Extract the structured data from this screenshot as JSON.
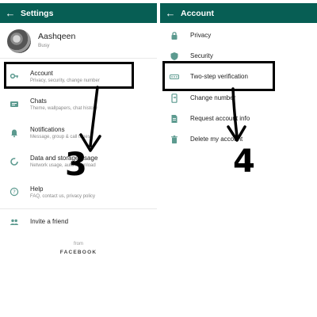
{
  "left_screen": {
    "appbar": {
      "title": "Settings",
      "back_icon": "arrow-left-icon"
    },
    "profile": {
      "name": "Aashqeen",
      "status": "Busy"
    },
    "items": [
      {
        "icon": "key-icon",
        "label": "Account",
        "sub": "Privacy, security, change number"
      },
      {
        "icon": "chat-icon",
        "label": "Chats",
        "sub": "Theme, wallpapers, chat history"
      },
      {
        "icon": "bell-icon",
        "label": "Notifications",
        "sub": "Message, group & call tones"
      },
      {
        "icon": "data-usage-icon",
        "label": "Data and storage usage",
        "sub": "Network usage, auto-download"
      },
      {
        "icon": "help-icon",
        "label": "Help",
        "sub": "FAQ, contact us, privacy policy"
      },
      {
        "icon": "people-icon",
        "label": "Invite a friend",
        "sub": ""
      }
    ],
    "footer": {
      "from": "from",
      "brand": "FACEBOOK"
    },
    "step_number": "3"
  },
  "right_screen": {
    "appbar": {
      "title": "Account",
      "back_icon": "arrow-left-icon"
    },
    "items": [
      {
        "icon": "lock-icon",
        "label": "Privacy"
      },
      {
        "icon": "shield-icon",
        "label": "Security"
      },
      {
        "icon": "dots-icon",
        "label": "Two-step verification"
      },
      {
        "icon": "phone-swap-icon",
        "label": "Change number"
      },
      {
        "icon": "document-icon",
        "label": "Request account info"
      },
      {
        "icon": "trash-icon",
        "label": "Delete my account"
      }
    ],
    "step_number": "4"
  },
  "colors": {
    "appbar": "#075e54",
    "icon": "#5c9a8f",
    "annotation": "#000000"
  }
}
